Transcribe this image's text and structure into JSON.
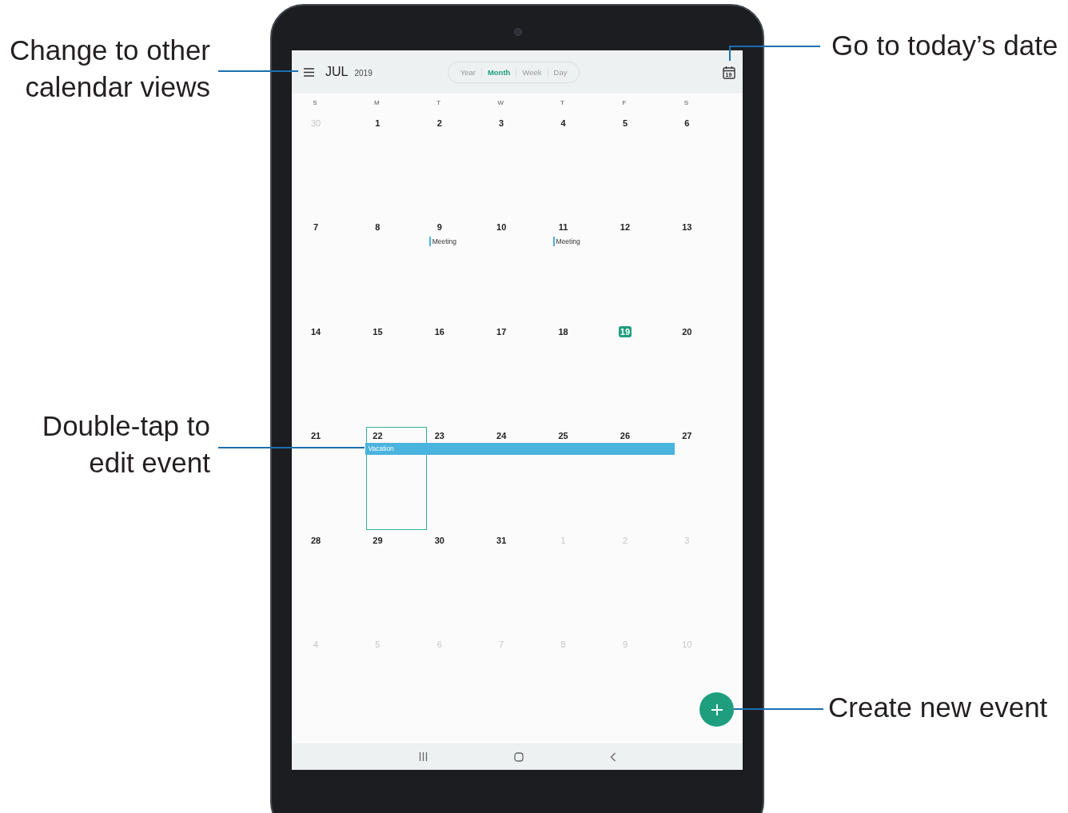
{
  "header": {
    "month": "JUL",
    "year": "2019",
    "views": [
      {
        "label": "Year",
        "selected": false
      },
      {
        "label": "Month",
        "selected": true
      },
      {
        "label": "Week",
        "selected": false
      },
      {
        "label": "Day",
        "selected": false
      }
    ]
  },
  "weekdays": [
    "S",
    "M",
    "T",
    "W",
    "T",
    "F",
    "S"
  ],
  "weeks": [
    [
      {
        "day": "30",
        "muted": true,
        "today": false
      },
      {
        "day": "1",
        "muted": false,
        "today": false
      },
      {
        "day": "2",
        "muted": false,
        "today": false
      },
      {
        "day": "3",
        "muted": false,
        "today": false
      },
      {
        "day": "4",
        "muted": false,
        "today": false
      },
      {
        "day": "5",
        "muted": false,
        "today": false
      },
      {
        "day": "6",
        "muted": false,
        "today": false
      }
    ],
    [
      {
        "day": "7",
        "muted": false,
        "today": false
      },
      {
        "day": "8",
        "muted": false,
        "today": false
      },
      {
        "day": "9",
        "muted": false,
        "today": false,
        "events": [
          {
            "kind": "meeting",
            "title": "Meeting"
          }
        ]
      },
      {
        "day": "10",
        "muted": false,
        "today": false
      },
      {
        "day": "11",
        "muted": false,
        "today": false,
        "events": [
          {
            "kind": "meeting",
            "title": "Meeting"
          }
        ]
      },
      {
        "day": "12",
        "muted": false,
        "today": false
      },
      {
        "day": "13",
        "muted": false,
        "today": false
      }
    ],
    [
      {
        "day": "14",
        "muted": false,
        "today": false
      },
      {
        "day": "15",
        "muted": false,
        "today": false
      },
      {
        "day": "16",
        "muted": false,
        "today": false
      },
      {
        "day": "17",
        "muted": false,
        "today": false
      },
      {
        "day": "18",
        "muted": false,
        "today": false
      },
      {
        "day": "19",
        "muted": false,
        "today": true
      },
      {
        "day": "20",
        "muted": false,
        "today": false
      }
    ],
    [
      {
        "day": "21",
        "muted": false,
        "today": false
      },
      {
        "day": "22",
        "muted": false,
        "today": false,
        "selected": true,
        "events": [
          {
            "kind": "span_start",
            "title": "Vacation"
          }
        ]
      },
      {
        "day": "23",
        "muted": false,
        "today": false,
        "events": [
          {
            "kind": "span"
          }
        ]
      },
      {
        "day": "24",
        "muted": false,
        "today": false,
        "events": [
          {
            "kind": "span"
          }
        ]
      },
      {
        "day": "25",
        "muted": false,
        "today": false,
        "events": [
          {
            "kind": "span"
          }
        ]
      },
      {
        "day": "26",
        "muted": false,
        "today": false,
        "events": [
          {
            "kind": "span"
          }
        ]
      },
      {
        "day": "27",
        "muted": false,
        "today": false
      }
    ],
    [
      {
        "day": "28",
        "muted": false,
        "today": false
      },
      {
        "day": "29",
        "muted": false,
        "today": false
      },
      {
        "day": "30",
        "muted": false,
        "today": false
      },
      {
        "day": "31",
        "muted": false,
        "today": false
      },
      {
        "day": "1",
        "muted": true,
        "today": false
      },
      {
        "day": "2",
        "muted": true,
        "today": false
      },
      {
        "day": "3",
        "muted": true,
        "today": false
      }
    ],
    [
      {
        "day": "4",
        "muted": true,
        "today": false
      },
      {
        "day": "5",
        "muted": true,
        "today": false
      },
      {
        "day": "6",
        "muted": true,
        "today": false
      },
      {
        "day": "7",
        "muted": true,
        "today": false
      },
      {
        "day": "8",
        "muted": true,
        "today": false
      },
      {
        "day": "9",
        "muted": true,
        "today": false
      },
      {
        "day": "10",
        "muted": true,
        "today": false
      }
    ]
  ],
  "today_icon": {
    "label": "19"
  },
  "callouts": [
    {
      "kind": "menu",
      "text": "Change to other\ncalendar views"
    },
    {
      "kind": "today",
      "text": "Go to today’s date"
    },
    {
      "kind": "edit",
      "text": "Double-tap to\nedit event"
    },
    {
      "kind": "create",
      "text": "Create new event"
    }
  ]
}
